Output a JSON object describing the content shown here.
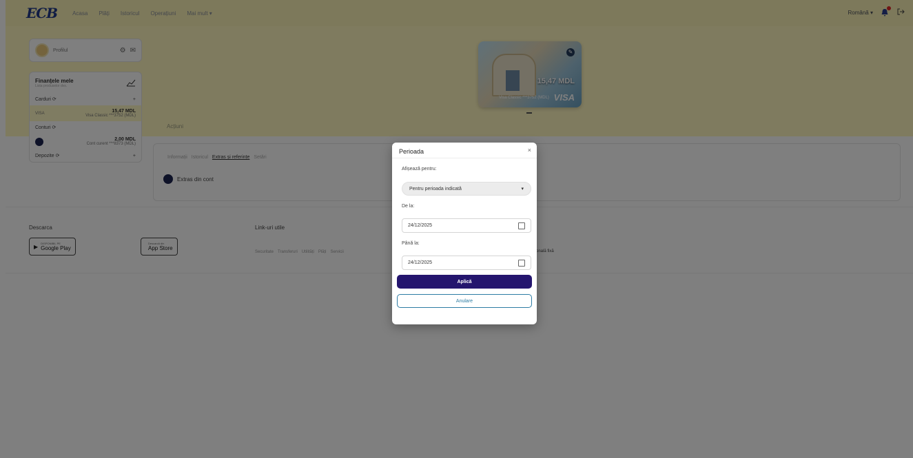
{
  "header": {
    "logo": "ECB",
    "nav": [
      "Acasa",
      "Plăți",
      "Istoricul",
      "Operațiuni",
      "Mai mult ▾"
    ],
    "language": "Română ▾"
  },
  "hero": {
    "card_amount": "15,47 MDL",
    "card_mask": "Visa Classic ***3752 (MDL)",
    "card_brand": "VISA",
    "actions_label": "Acțiuni"
  },
  "sidebar": {
    "user_name": "Profilul",
    "fin_title": "Finanțele mele",
    "fin_subtitle": "Lista produselor dvs.",
    "cards_label": "Carduri ⟳",
    "card_type": "VISA",
    "card_amount": "15,47 MDL",
    "card_desc": "Visa Classic ***3752 (MDL)",
    "accounts_label": "Conturi ⟳",
    "account_amount": "2,00 MDL",
    "account_desc": "Cont curent ***8373 (MDL)",
    "deposits_label": "Depozite ⟳",
    "plus": "+"
  },
  "tabs": {
    "items": [
      "Informații",
      "Istoricul",
      "Extras și referințe",
      "Setări"
    ],
    "extras_label": "Extras din cont"
  },
  "footer": {
    "download_title": "Descarca",
    "google_small": "DISPONIBIL PE",
    "google_label": "Google Play",
    "apple_small": "Descarcă din",
    "apple_label": "App Store",
    "links_title": "Link-uri utile",
    "links": [
      "Securitate",
      "Transferuri",
      "Utilități",
      "Plăți",
      "Servicii"
    ],
    "tail_text": "onală fixă"
  },
  "modal": {
    "title": "Perioada",
    "close": "×",
    "show_for_label": "Afișează pentru:",
    "period_value": "Pentru perioada indicată",
    "from_label": "De la:",
    "from_value": "24/12/2025",
    "to_label": "Până la:",
    "to_value": "24/12/2025",
    "apply": "Aplică",
    "cancel": "Anulare"
  }
}
